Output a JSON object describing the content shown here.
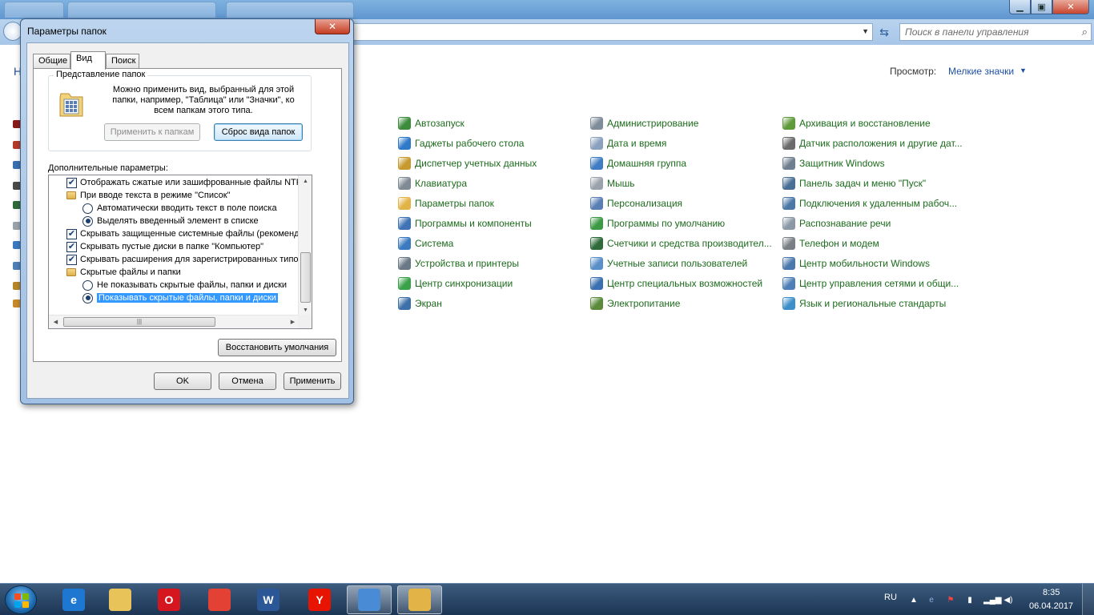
{
  "window": {
    "search_placeholder": "Поиск в панели управления",
    "view_by_label": "Просмотр:",
    "view_by_value": "Мелкие значки",
    "h_letter": "Н"
  },
  "items": [
    {
      "label": "Автозапуск",
      "icon": "autoplay-icon",
      "color": "#3c8c3c"
    },
    {
      "label": "Администрирование",
      "icon": "admin-tools-icon",
      "color": "#7f8c99"
    },
    {
      "label": "Архивация и восстановление",
      "icon": "backup-icon",
      "color": "#5f9b3a"
    },
    {
      "label": "Гаджеты рабочего стола",
      "icon": "gadgets-icon",
      "color": "#2f79c9"
    },
    {
      "label": "Дата и время",
      "icon": "clock-icon",
      "color": "#8ba1bd"
    },
    {
      "label": "Датчик расположения и другие дат...",
      "icon": "sensor-icon",
      "color": "#6b6b6b"
    },
    {
      "label": "Диспетчер учетных данных",
      "icon": "credential-icon",
      "color": "#c79a2d"
    },
    {
      "label": "Домашняя группа",
      "icon": "homegroup-icon",
      "color": "#3f7cc3"
    },
    {
      "label": "Защитник Windows",
      "icon": "defender-icon",
      "color": "#6f7f8f"
    },
    {
      "label": "Клавиатура",
      "icon": "keyboard-icon",
      "color": "#808a94"
    },
    {
      "label": "Мышь",
      "icon": "mouse-icon",
      "color": "#9aa3ab"
    },
    {
      "label": "Панель задач и меню \"Пуск\"",
      "icon": "taskbar-icon",
      "color": "#4a6f96"
    },
    {
      "label": "Параметры папок",
      "icon": "folder-options-icon",
      "color": "#e2b347"
    },
    {
      "label": "Персонализация",
      "icon": "personalization-icon",
      "color": "#5a7fb5"
    },
    {
      "label": "Подключения к удаленным рабоч...",
      "icon": "remote-desktop-icon",
      "color": "#4c78a8"
    },
    {
      "label": "Программы и компоненты",
      "icon": "programs-icon",
      "color": "#3f73b5"
    },
    {
      "label": "Программы по умолчанию",
      "icon": "default-programs-icon",
      "color": "#3c9a44"
    },
    {
      "label": "Распознавание речи",
      "icon": "speech-icon",
      "color": "#8b98a6"
    },
    {
      "label": "Система",
      "icon": "system-icon",
      "color": "#3b7ac0"
    },
    {
      "label": "Счетчики и средства производител...",
      "icon": "performance-icon",
      "color": "#2e6a3a"
    },
    {
      "label": "Телефон и модем",
      "icon": "phone-icon",
      "color": "#7a7f86"
    },
    {
      "label": "Устройства и принтеры",
      "icon": "printer-icon",
      "color": "#6b7885"
    },
    {
      "label": "Учетные записи пользователей",
      "icon": "users-icon",
      "color": "#5b8fc9"
    },
    {
      "label": "Центр мобильности Windows",
      "icon": "mobility-icon",
      "color": "#4c79ad"
    },
    {
      "label": "Центр синхронизации",
      "icon": "sync-icon",
      "color": "#3aa34a"
    },
    {
      "label": "Центр специальных возможностей",
      "icon": "accessibility-icon",
      "color": "#3a6fb0"
    },
    {
      "label": "Центр управления сетями и общи...",
      "icon": "network-icon",
      "color": "#4e7fb6"
    },
    {
      "label": "Экран",
      "icon": "display-icon",
      "color": "#3d6fa8"
    },
    {
      "label": "Электропитание",
      "icon": "power-icon",
      "color": "#5a8a3a"
    },
    {
      "label": "Язык и региональные стандарты",
      "icon": "region-icon",
      "color": "#3d8fc9"
    }
  ],
  "dialog": {
    "title": "Параметры папок",
    "close_glyph": "✕",
    "tabs": [
      "Общие",
      "Вид",
      "Поиск"
    ],
    "group_title": "Представление папок",
    "group_desc": "Можно применить вид, выбранный для этой папки, например, \"Таблица\" или \"Значки\", ко всем папкам этого типа.",
    "apply_to_folders": "Применить к папкам",
    "reset_folders": "Сброс вида папок",
    "advanced_label": "Дополнительные параметры:",
    "advanced_rows": [
      {
        "type": "checkbox",
        "checked": true,
        "indent": 0,
        "text": "Отображать сжатые или зашифрованные файлы NTFS"
      },
      {
        "type": "folder",
        "indent": 0,
        "text": "При вводе текста в режиме \"Список\""
      },
      {
        "type": "radio",
        "checked": false,
        "indent": 1,
        "text": "Автоматически вводить текст в поле поиска"
      },
      {
        "type": "radio",
        "checked": true,
        "indent": 1,
        "text": "Выделять введенный элемент в списке"
      },
      {
        "type": "checkbox",
        "checked": true,
        "indent": 0,
        "text": "Скрывать защищенные системные файлы (рекомендуется)"
      },
      {
        "type": "checkbox",
        "checked": true,
        "indent": 0,
        "text": "Скрывать пустые диски в папке \"Компьютер\""
      },
      {
        "type": "checkbox",
        "checked": true,
        "indent": 0,
        "text": "Скрывать расширения для зарегистрированных типов файлов"
      },
      {
        "type": "folder",
        "indent": 0,
        "text": "Скрытые файлы и папки"
      },
      {
        "type": "radio",
        "checked": false,
        "indent": 1,
        "text": "Не показывать скрытые файлы, папки и диски"
      },
      {
        "type": "radio",
        "checked": true,
        "indent": 1,
        "selected": true,
        "text": "Показывать скрытые файлы, папки и диски"
      }
    ],
    "restore_defaults": "Восстановить умолчания",
    "ok": "OK",
    "cancel": "Отмена",
    "apply": "Применить"
  },
  "taskbar": {
    "apps": [
      {
        "name": "ie",
        "label": "e",
        "color": "#1e78d2"
      },
      {
        "name": "explorer",
        "label": "",
        "color": "#e7c35a"
      },
      {
        "name": "opera",
        "label": "O",
        "color": "#d6161e"
      },
      {
        "name": "chrome",
        "label": "",
        "color": "#e34133"
      },
      {
        "name": "word",
        "label": "W",
        "color": "#2b5797"
      },
      {
        "name": "yandex",
        "label": "Y",
        "color": "#e61400"
      },
      {
        "name": "control-panel",
        "label": "",
        "color": "#4a8bd6"
      },
      {
        "name": "folder-options",
        "label": "",
        "color": "#e2b347"
      }
    ],
    "lang": "RU",
    "time": "8:35",
    "date": "06.04.2017"
  }
}
